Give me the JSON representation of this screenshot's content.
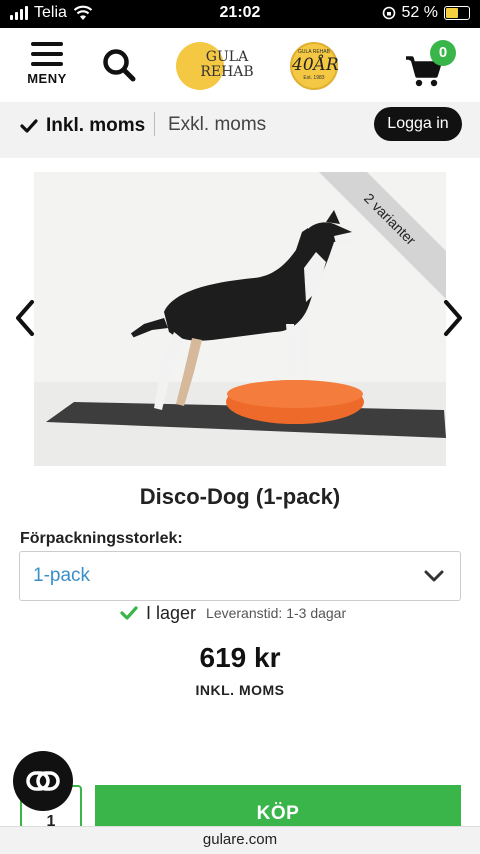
{
  "status_bar": {
    "carrier": "Telia",
    "time": "21:02",
    "battery_text": "52 %"
  },
  "header": {
    "menu_label": "MENY",
    "logo_text_line1": "GULA",
    "logo_text_line2": "REHAB",
    "anniversary_top": "GULA REHAB",
    "anniversary_number": "40ÅR",
    "anniversary_bottom": "Est. 1983",
    "cart_count": "0",
    "accent_color": "#39b54a"
  },
  "tax_bar": {
    "incl_label": "Inkl. moms",
    "excl_label": "Exkl. moms",
    "login_label": "Logga in"
  },
  "product": {
    "variant_badge": "2 varianter",
    "title": "Disco-Dog (1-pack)",
    "pack_label": "Förpackningsstorlek:",
    "pack_value": "1-pack",
    "stock_status": "I lager",
    "lead_time": "Leveranstid: 1-3 dagar",
    "price": "619 kr",
    "price_note": "INKL. MOMS",
    "quantity": "1",
    "buy_label": "KÖP"
  },
  "browser": {
    "url": "gulare.com"
  },
  "icons": {
    "menu": "hamburger-icon",
    "search": "search-icon",
    "cart": "cart-icon",
    "check": "check-icon",
    "chevron_down": "chevron-down-icon",
    "prev": "chevron-left-icon",
    "next": "chevron-right-icon",
    "chat": "chat-icon"
  }
}
